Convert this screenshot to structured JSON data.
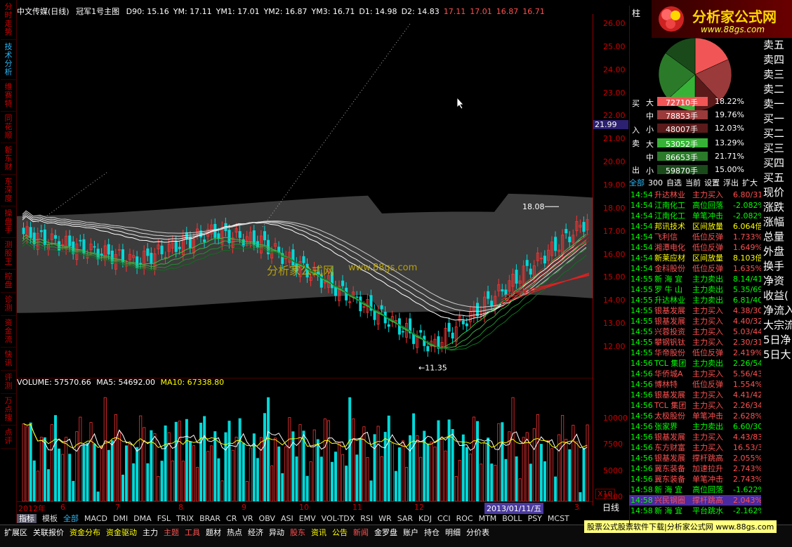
{
  "left_tabs": [
    "分时走势",
    "技术分析",
    "维赛特",
    "同花顺",
    "新东财",
    "东深度",
    "操盘手",
    "测股王",
    "控盘",
    "诊测",
    "资金流",
    "快讯",
    "评测",
    "万点搜",
    "点评"
  ],
  "left_tab_active_index": 1,
  "topbar": {
    "title": "中文传媒(日线)",
    "indicator": "冠军1号主图",
    "values": [
      "D90: 15.16",
      "YM: 17.11",
      "YM1: 17.01",
      "YM2: 16.87",
      "YM3: 16.71",
      "D1: 14.98",
      "D2: 14.83"
    ],
    "extra": [
      "17.11",
      "17.01",
      "16.87",
      "16.71"
    ]
  },
  "price_axis": [
    "26.00",
    "25.00",
    "24.00",
    "23.00",
    "22.00",
    "21.00",
    "20.00",
    "19.00",
    "18.00",
    "17.00",
    "16.00",
    "15.00",
    "14.00",
    "13.00",
    "12.00"
  ],
  "current_price_tag": "21.99",
  "high_label": "18.08",
  "low_label": "11.35",
  "volume_header": {
    "volume": "VOLUME: 57570.66",
    "ma5": "MA5: 54692.00",
    "ma10": "MA10: 67338.80"
  },
  "volume_axis": [
    "10000",
    "7500",
    "5000",
    "2500"
  ],
  "volume_multiplier": "X10",
  "time_axis": [
    "2012年",
    "6",
    "7",
    "8",
    "9",
    "10",
    "11",
    "12",
    "2013/01/11/五",
    "3"
  ],
  "time_unit": "日线",
  "indicator_tabs": [
    "指标",
    "模板",
    "全部",
    "MACD",
    "DMI",
    "DMA",
    "FSL",
    "TRIX",
    "BRAR",
    "CR",
    "VR",
    "OBV",
    "ASI",
    "EMV",
    "VOL-TDX",
    "RSI",
    "WR",
    "SAR",
    "KDJ",
    "CCI",
    "ROC",
    "MTM",
    "BOLL",
    "PSY",
    "MCST"
  ],
  "bottom_tabs": [
    "扩展区",
    "关联报价",
    "资金分布",
    "资金驱动",
    "主力",
    "主题",
    "工具",
    "题材",
    "热点",
    "经济",
    "异动",
    "股东",
    "资讯",
    "公告",
    "新闻",
    "金罗盘",
    "账户",
    "持仓",
    "明细",
    "分价表"
  ],
  "bottom_note": "股票公式股票软件下载|分析家公式网 www.88gs.com",
  "logo": {
    "title": "分析家公式网",
    "url": "www.88gs.com"
  },
  "pie_label": "柱",
  "money_flow": {
    "buy": [
      {
        "label": "大",
        "hands": "72710手",
        "pct": "18.22%",
        "color": "#f25555"
      },
      {
        "label": "中",
        "hands": "78853手",
        "pct": "19.76%",
        "color": "#9a3a3a"
      },
      {
        "label": "小",
        "hands": "48007手",
        "pct": "12.03%",
        "color": "#5a1a1a"
      }
    ],
    "sell": [
      {
        "label": "大",
        "hands": "53052手",
        "pct": "13.29%",
        "color": "#36b336"
      },
      {
        "label": "中",
        "hands": "86653手",
        "pct": "21.71%",
        "color": "#2a7a2a"
      },
      {
        "label": "小",
        "hands": "59870手",
        "pct": "15.00%",
        "color": "#1a4a1a"
      }
    ],
    "side_words": [
      "买",
      "入",
      "卖",
      "出"
    ]
  },
  "list_tabs": [
    "全部",
    "300",
    "自选",
    "当前",
    "设置",
    "浮出",
    "扩大"
  ],
  "ticker": [
    {
      "time": "14:54",
      "name": "升达林业",
      "type": "主力买入",
      "value": "6.80/31",
      "color": "#ff5050"
    },
    {
      "time": "14:54",
      "name": "江南化工",
      "type": "高位回落",
      "value": "-2.082%",
      "color": "#0f0"
    },
    {
      "time": "14:54",
      "name": "江南化工",
      "type": "单笔冲击",
      "value": "-2.082%",
      "color": "#0f0"
    },
    {
      "time": "14:54",
      "name": "邦讯技术",
      "type": "区间放量",
      "value": "6.064倍",
      "color": "#ff0"
    },
    {
      "time": "14:54",
      "name": "飞利信",
      "type": "低位反弹",
      "value": "1.733%",
      "color": "#ff5050"
    },
    {
      "time": "14:54",
      "name": "湘潭电化",
      "type": "低位反弹",
      "value": "1.649%",
      "color": "#ff5050"
    },
    {
      "time": "14:54",
      "name": "新莱应材",
      "type": "区间放量",
      "value": "8.103倍",
      "color": "#ff0"
    },
    {
      "time": "14:54",
      "name": "金科股份",
      "type": "低位反弹",
      "value": "1.635%",
      "color": "#ff5050"
    },
    {
      "time": "14:55",
      "name": "新 海 宜",
      "type": "主力卖出",
      "value": "8.14/41",
      "color": "#0f0"
    },
    {
      "time": "14:55",
      "name": "罗 牛 山",
      "type": "主力卖出",
      "value": "5.35/69",
      "color": "#0f0"
    },
    {
      "time": "14:55",
      "name": "升达林业",
      "type": "主力卖出",
      "value": "6.81/40",
      "color": "#0f0"
    },
    {
      "time": "14:55",
      "name": "银基发展",
      "type": "主力买入",
      "value": "4.38/30",
      "color": "#ff5050"
    },
    {
      "time": "14:55",
      "name": "银基发展",
      "type": "主力买入",
      "value": "4.40/32",
      "color": "#ff5050"
    },
    {
      "time": "14:55",
      "name": "兴蓉投资",
      "type": "主力买入",
      "value": "5.03/44",
      "color": "#ff5050"
    },
    {
      "time": "14:55",
      "name": "攀钢钒钛",
      "type": "主力买入",
      "value": "2.30/31",
      "color": "#ff5050"
    },
    {
      "time": "14:55",
      "name": "华帝股份",
      "type": "低位反弹",
      "value": "2.419%",
      "color": "#ff5050"
    },
    {
      "time": "14:56",
      "name": "TCL 集团",
      "type": "主力卖出",
      "value": "2.26/54",
      "color": "#0f0"
    },
    {
      "time": "14:56",
      "name": "华侨城A",
      "type": "主力买入",
      "value": "5.56/43",
      "color": "#ff5050"
    },
    {
      "time": "14:56",
      "name": "博林特",
      "type": "低位反弹",
      "value": "1.554%",
      "color": "#ff5050"
    },
    {
      "time": "14:56",
      "name": "银基发展",
      "type": "主力买入",
      "value": "4.41/42",
      "color": "#ff5050"
    },
    {
      "time": "14:56",
      "name": "TCL 集团",
      "type": "主力买入",
      "value": "2.26/34",
      "color": "#ff5050"
    },
    {
      "time": "14:56",
      "name": "太极股份",
      "type": "单笔冲击",
      "value": "2.628%",
      "color": "#ff5050"
    },
    {
      "time": "14:56",
      "name": "张家界",
      "type": "主力卖出",
      "value": "6.60/30",
      "color": "#0f0"
    },
    {
      "time": "14:56",
      "name": "银基发展",
      "type": "主力买入",
      "value": "4.43/83",
      "color": "#ff5050"
    },
    {
      "time": "14:56",
      "name": "东方财富",
      "type": "主力买入",
      "value": "16.53/3",
      "color": "#ff5050"
    },
    {
      "time": "14:56",
      "name": "银基发展",
      "type": "撑杆跳高",
      "value": "2.055%",
      "color": "#ff5050"
    },
    {
      "time": "14:56",
      "name": "冀东装备",
      "type": "加速拉升",
      "value": "2.743%",
      "color": "#ff5050"
    },
    {
      "time": "14:56",
      "name": "冀东装备",
      "type": "单笔冲击",
      "value": "2.743%",
      "color": "#ff5050"
    },
    {
      "time": "14:58",
      "name": "新 海 宜",
      "type": "高位回落",
      "value": "-1.622%",
      "color": "#0f0"
    },
    {
      "time": "14:58",
      "name": "兴民钢圈",
      "type": "撑杆跳高",
      "value": "2.043%",
      "color": "#ff5050"
    },
    {
      "time": "14:58",
      "name": "新 海 宜",
      "type": "平台跳水",
      "value": "-2.162%",
      "color": "#0f0"
    }
  ],
  "far_right": [
    "卖五",
    "卖四",
    "卖三",
    "卖二",
    "卖一",
    "买一",
    "买二",
    "买三",
    "买四",
    "买五",
    "现价",
    "涨跌",
    "涨幅",
    "总量",
    "外盘",
    "换手",
    "净资",
    "收益(",
    "净流入",
    "大宗流",
    "5日净",
    "5日大"
  ],
  "watermark": {
    "cn": "分析家公式网",
    "url": "www.88gs.com"
  }
}
